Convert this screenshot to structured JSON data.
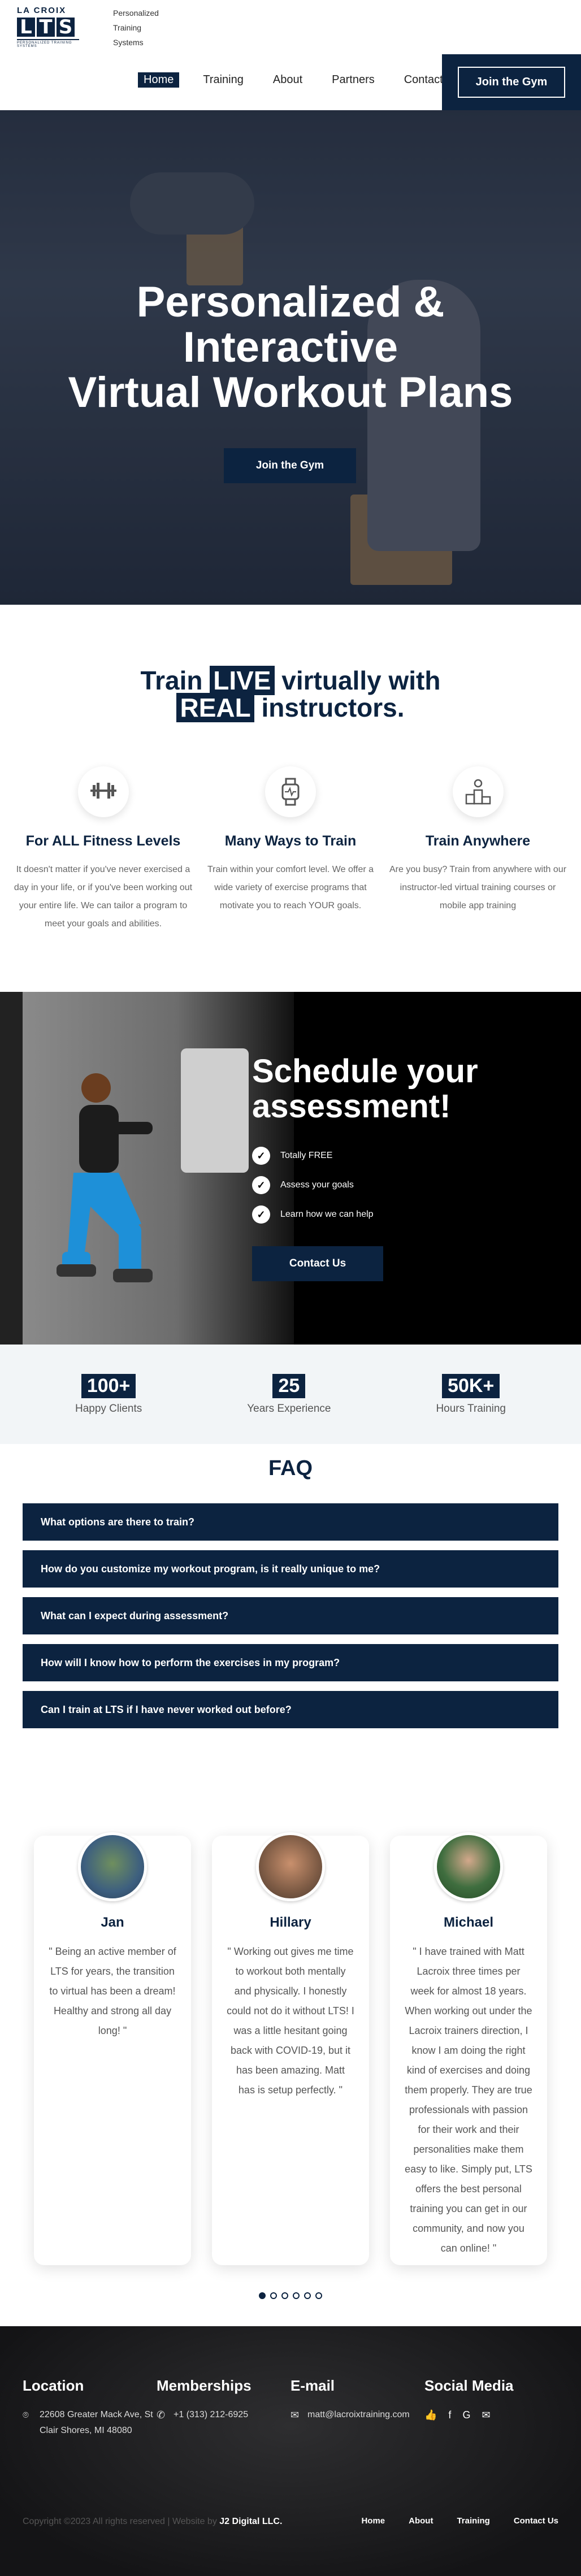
{
  "brand": {
    "logo_top": "LA CROIX",
    "logo_mark": "LTS",
    "logo_sub": "PERSONALIZED TRAINING SYSTEMS",
    "tagline": [
      "Personalized",
      "Training",
      "Systems"
    ]
  },
  "nav": {
    "items": [
      "Home",
      "Training",
      "About",
      "Partners",
      "Contact"
    ],
    "active": "Home",
    "join_label": "Join the Gym"
  },
  "hero": {
    "title_lines": [
      "Personalized &",
      "Interactive",
      "Virtual Workout Plans"
    ],
    "button": "Join the Gym"
  },
  "live": {
    "pre": "Train",
    "box1": "LIVE",
    "mid": "virtually with",
    "box2": "REAL",
    "post": "instructors."
  },
  "features": [
    {
      "icon": "barbell-icon",
      "title": "For ALL Fitness Levels",
      "text": "It doesn't matter if you've never exercised a day in your life, or if you've been working out your entire life. We can tailor a program to meet your goals and abilities."
    },
    {
      "icon": "smartwatch-icon",
      "title": "Many Ways to Train",
      "text": "Train within your comfort level. We offer a wide variety of exercise programs that motivate you to reach YOUR goals."
    },
    {
      "icon": "podium-icon",
      "title": "Train Anywhere",
      "text": "Are you busy? Train from anywhere with our instructor-led virtual training courses or mobile app training"
    }
  ],
  "schedule": {
    "title_lines": [
      "Schedule your",
      "assessment!"
    ],
    "items": [
      "Totally FREE",
      "Assess your goals",
      "Learn how we can help"
    ],
    "button": "Contact Us"
  },
  "stats": [
    {
      "num": "100+",
      "label": "Happy Clients"
    },
    {
      "num": "25",
      "label": "Years Experience"
    },
    {
      "num": "50K+",
      "label": "Hours Training"
    }
  ],
  "faq": {
    "title": "FAQ",
    "items": [
      "What options are there to train?",
      "How do you customize my workout program, is it really unique to me?",
      "What can I expect during assessment?",
      "How will I know how to perform the exercises in my program?",
      "Can I train at LTS if I have never worked out before?"
    ]
  },
  "testimonials": [
    {
      "name": "Jan",
      "text": "\" Being an active member of LTS for years, the transition to virtual has been a dream! Healthy and strong all day long! \""
    },
    {
      "name": "Hillary",
      "text": "\" Working out gives me time to workout both mentally and physically. I honestly could not do it without LTS! I was a little hesitant going back with COVID-19, but it has been amazing. Matt has is setup perfectly. \""
    },
    {
      "name": "Michael",
      "text": "\" I have trained with Matt Lacroix three times per week for almost 18 years. When working out under the Lacroix trainers direction, I know I am doing the right kind of exercises and doing them properly. They are true professionals with passion for their work and their personalities make them easy to like. Simply put, LTS offers the best personal training you can get in our community, and now you can online! \""
    }
  ],
  "footer": {
    "location_title": "Location",
    "address": "22608 Greater Mack Ave, St Clair Shores, MI 48080",
    "memberships_title": "Memberships",
    "phone": "+1 (313) 212-6925",
    "email_title": "E-mail",
    "email": "matt@lacroixtraining.com",
    "social_title": "Social Media",
    "copyright": "Copyright ©2023 All rights reserved | Website by",
    "credit": "J2 Digital LLC.",
    "links": [
      "Home",
      "About",
      "Training",
      "Contact Us"
    ]
  },
  "colors": {
    "navy": "#0c2340"
  }
}
